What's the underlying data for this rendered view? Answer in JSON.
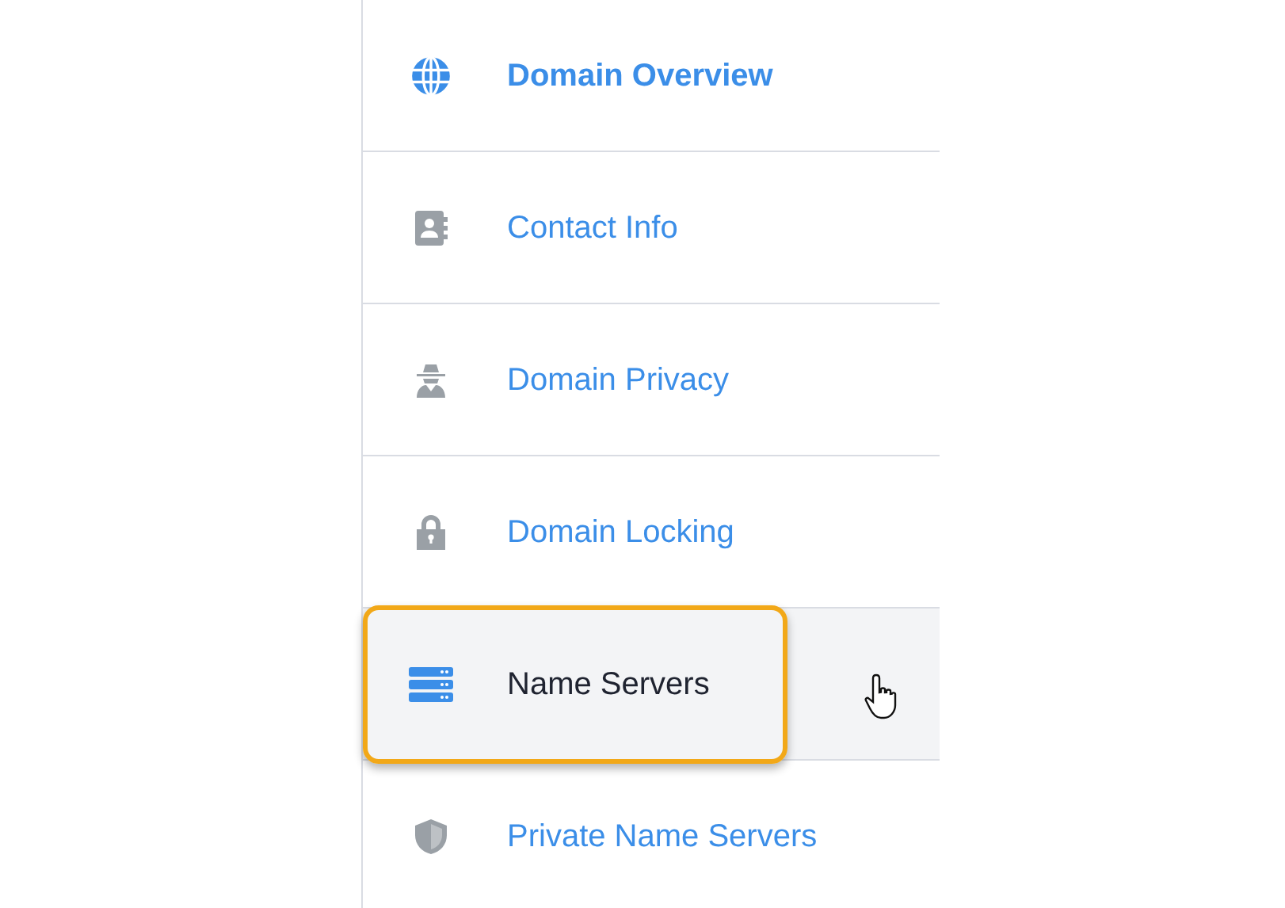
{
  "menu": {
    "items": [
      {
        "label": "Domain Overview",
        "current": true,
        "highlighted": false
      },
      {
        "label": "Contact Info",
        "current": false,
        "highlighted": false
      },
      {
        "label": "Domain Privacy",
        "current": false,
        "highlighted": false
      },
      {
        "label": "Domain Locking",
        "current": false,
        "highlighted": false
      },
      {
        "label": "Name Servers",
        "current": false,
        "highlighted": true
      },
      {
        "label": "Private Name Servers",
        "current": false,
        "highlighted": false
      }
    ]
  }
}
